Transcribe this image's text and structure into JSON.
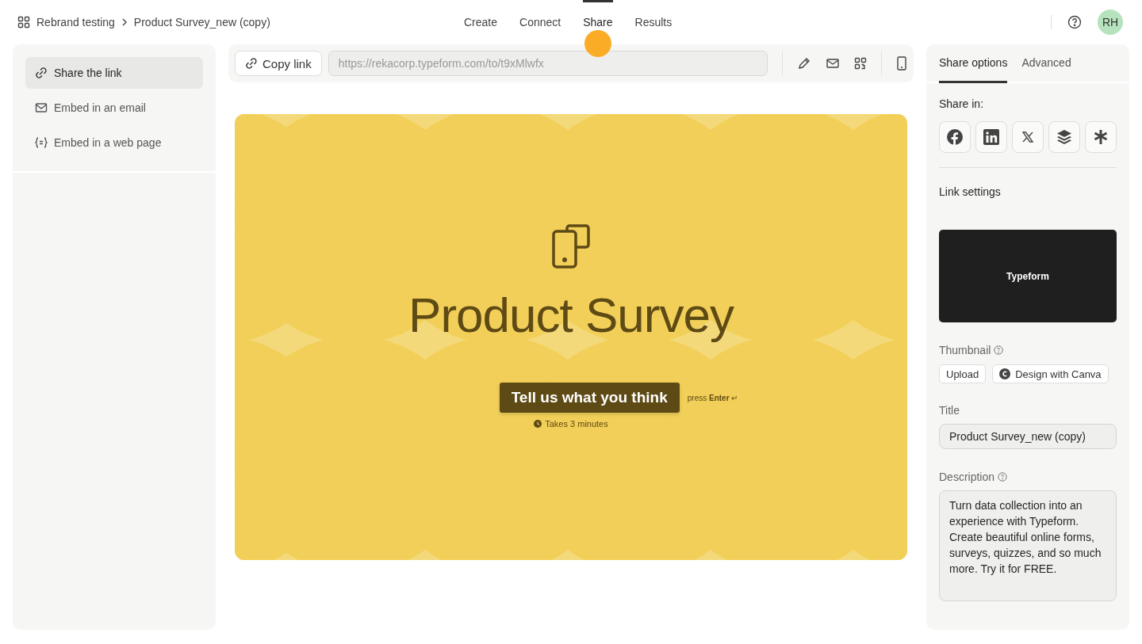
{
  "breadcrumb": {
    "workspace": "Rebrand testing",
    "form": "Product Survey_new (copy)"
  },
  "nav_tabs": [
    {
      "label": "Create",
      "selected": false
    },
    {
      "label": "Connect",
      "selected": false
    },
    {
      "label": "Share",
      "selected": true
    },
    {
      "label": "Results",
      "selected": false
    }
  ],
  "avatar": {
    "initials": "RH"
  },
  "sidebar": {
    "items": [
      {
        "label": "Share the link",
        "selected": true
      },
      {
        "label": "Embed in an email",
        "selected": false
      },
      {
        "label": "Embed in a web page",
        "selected": false
      }
    ]
  },
  "link_bar": {
    "copy_button": "Copy link",
    "url": "https://rekacorp.typeform.com/to/t9xMlwfx"
  },
  "preview": {
    "title": "Product Survey",
    "button": "Tell us what you think",
    "hint": "press **Enter** ↵",
    "duration": "Takes 3 minutes"
  },
  "panel": {
    "tabs": [
      {
        "label": "Share options",
        "selected": true
      },
      {
        "label": "Advanced",
        "selected": false
      }
    ],
    "share_in": "Share in:",
    "link_settings": "Link settings",
    "thumbnail_card": "Typeform",
    "thumbnail_label": "Thumbnail",
    "upload": "Upload",
    "canva": "Design with Canva",
    "title_label": "Title",
    "title_value": "Product Survey_new (copy)",
    "description_label": "Description",
    "description_value": "Turn data collection into an experience with Typeform. Create beautiful online forms, surveys, quizzes, and so much more. Try it for FREE."
  }
}
